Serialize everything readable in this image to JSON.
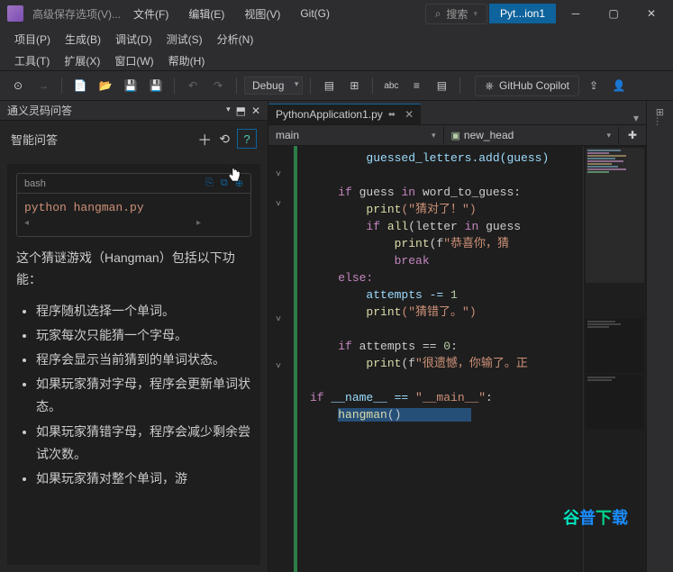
{
  "titlebar": {
    "title": "高级保存选项(V)...",
    "search_label": "搜索",
    "doc": "Pyt...ion1"
  },
  "menu": {
    "file": "文件(F)",
    "edit": "编辑(E)",
    "view": "视图(V)",
    "git": "Git(G)",
    "project": "项目(P)",
    "build": "生成(B)",
    "debug": "调试(D)",
    "test": "测试(S)",
    "analyze": "分析(N)",
    "tools": "工具(T)",
    "extensions": "扩展(X)",
    "window": "窗口(W)",
    "help": "帮助(H)"
  },
  "toolbar": {
    "config": "Debug",
    "copilot": "GitHub Copilot"
  },
  "left_panel": {
    "tab_title": "通义灵码问答",
    "subheader": "智能问答",
    "code_lang": "bash",
    "code_cmd": "python hangman.py",
    "description": "这个猜谜游戏（Hangman）包括以下功能：",
    "bullets": [
      "程序随机选择一个单词。",
      "玩家每次只能猜一个字母。",
      "程序会显示当前猜到的单词状态。",
      "如果玩家猜对字母，程序会更新单词状态。",
      "如果玩家猜错字母，程序会减少剩余尝试次数。",
      "如果玩家猜对整个单词，游"
    ]
  },
  "editor": {
    "tab_name": "PythonApplication1.py",
    "nav_scope": "main",
    "nav_member": "new_head",
    "code": {
      "l0": "guessed_letters.add(guess)",
      "l1_if": "if",
      "l1_rest": " guess ",
      "l1_in": "in",
      "l1_end": " word_to_guess:",
      "l2_print": "print",
      "l2_str": "(\"猜对了！\")",
      "l3_if": "if",
      "l3_all": " all",
      "l3_rest": "(letter ",
      "l3_in": "in",
      "l3_end": " guess",
      "l4_print": "print",
      "l4_f": "(f",
      "l4_str": "\"恭喜你，猜",
      "l5": "break",
      "l6": "else:",
      "l7_a": "attempts -= ",
      "l7_n": "1",
      "l8_print": "print",
      "l8_str": "(\"猜错了。\")",
      "l9_if": "if",
      "l9_rest": " attempts == ",
      "l9_n": "0",
      "l9_c": ":",
      "l10_print": "print",
      "l10_f": "(f",
      "l10_str": "\"很遗憾，你输了。正",
      "l11_if": "if",
      "l11_name": " __name__ == ",
      "l11_str": "\"__main__\"",
      "l11_c": ":",
      "l12": "hangman",
      "l12_p": "()"
    }
  },
  "watermark": "谷普下载"
}
